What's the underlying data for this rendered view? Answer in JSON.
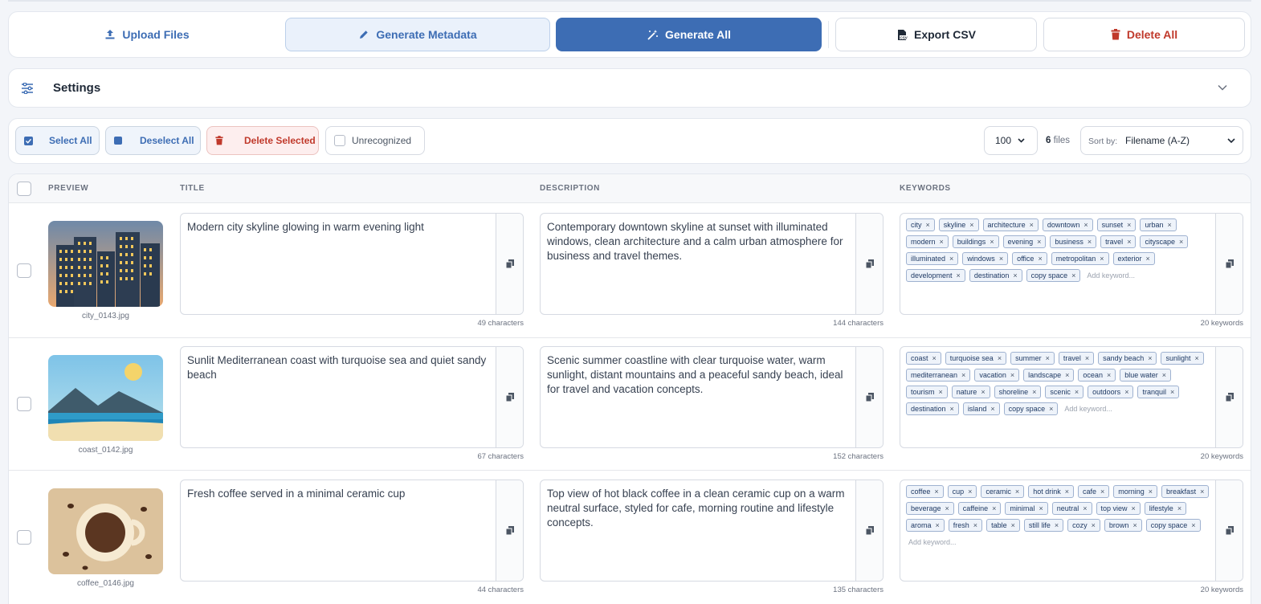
{
  "toolbar": {
    "upload_label": "Upload Files",
    "generate_metadata_label": "Generate Metadata",
    "generate_all_label": "Generate All",
    "export_csv_label": "Export CSV",
    "delete_all_label": "Delete All"
  },
  "settings": {
    "title": "Settings"
  },
  "selection": {
    "select_all_label": "Select All",
    "deselect_all_label": "Deselect All",
    "delete_selected_label": "Delete Selected",
    "unrecognized_label": "Unrecognized",
    "per_page": "100",
    "file_count": "6",
    "file_count_suffix": "files",
    "sort_label": "Sort by:",
    "sort_value": "Filename (A-Z)"
  },
  "table": {
    "headers": {
      "preview": "PREVIEW",
      "title": "TITLE",
      "description": "DESCRIPTION",
      "keywords": "KEYWORDS"
    },
    "add_keyword_placeholder": "Add keyword...",
    "rows": [
      {
        "filename": "city_0143.jpg",
        "title": "Modern city skyline glowing in warm evening light",
        "title_count": "49 characters",
        "description": "Contemporary downtown skyline at sunset with illuminated windows, clean architecture and a calm urban atmosphere for business and travel themes.",
        "description_count": "144 characters",
        "keywords": [
          "city",
          "skyline",
          "architecture",
          "downtown",
          "sunset",
          "urban",
          "modern",
          "buildings",
          "evening",
          "business",
          "travel",
          "cityscape",
          "illuminated",
          "windows",
          "office",
          "metropolitan",
          "exterior",
          "development",
          "destination",
          "copy space"
        ],
        "keywords_count": "20 keywords"
      },
      {
        "filename": "coast_0142.jpg",
        "title": "Sunlit Mediterranean coast with turquoise sea and quiet sandy beach",
        "title_count": "67 characters",
        "description": "Scenic summer coastline with clear turquoise water, warm sunlight, distant mountains and a peaceful sandy beach, ideal for travel and vacation concepts.",
        "description_count": "152 characters",
        "keywords": [
          "coast",
          "turquoise sea",
          "summer",
          "travel",
          "sandy beach",
          "sunlight",
          "mediterranean",
          "vacation",
          "landscape",
          "ocean",
          "blue water",
          "tourism",
          "nature",
          "shoreline",
          "scenic",
          "outdoors",
          "tranquil",
          "destination",
          "island",
          "copy space"
        ],
        "keywords_count": "20 keywords"
      },
      {
        "filename": "coffee_0146.jpg",
        "title": "Fresh coffee served in a minimal ceramic cup",
        "title_count": "44 characters",
        "description": "Top view of hot black coffee in a clean ceramic cup on a warm neutral surface, styled for cafe, morning routine and lifestyle concepts.",
        "description_count": "135 characters",
        "keywords": [
          "coffee",
          "cup",
          "ceramic",
          "hot drink",
          "cafe",
          "morning",
          "breakfast",
          "beverage",
          "caffeine",
          "minimal",
          "neutral",
          "top view",
          "lifestyle",
          "aroma",
          "fresh",
          "table",
          "still life",
          "cozy",
          "brown",
          "copy space"
        ],
        "keywords_count": "20 keywords"
      }
    ]
  },
  "colors": {
    "primary": "#3d6db4",
    "danger": "#c0392b",
    "primary_light": "#eaf1fb"
  },
  "icons": [
    "upload-icon",
    "pencil-icon",
    "magic-wand-icon",
    "csv-file-icon",
    "trash-icon",
    "sliders-icon",
    "chevron-down-icon",
    "copy-icon",
    "checkbox-checked-icon",
    "square-icon"
  ]
}
